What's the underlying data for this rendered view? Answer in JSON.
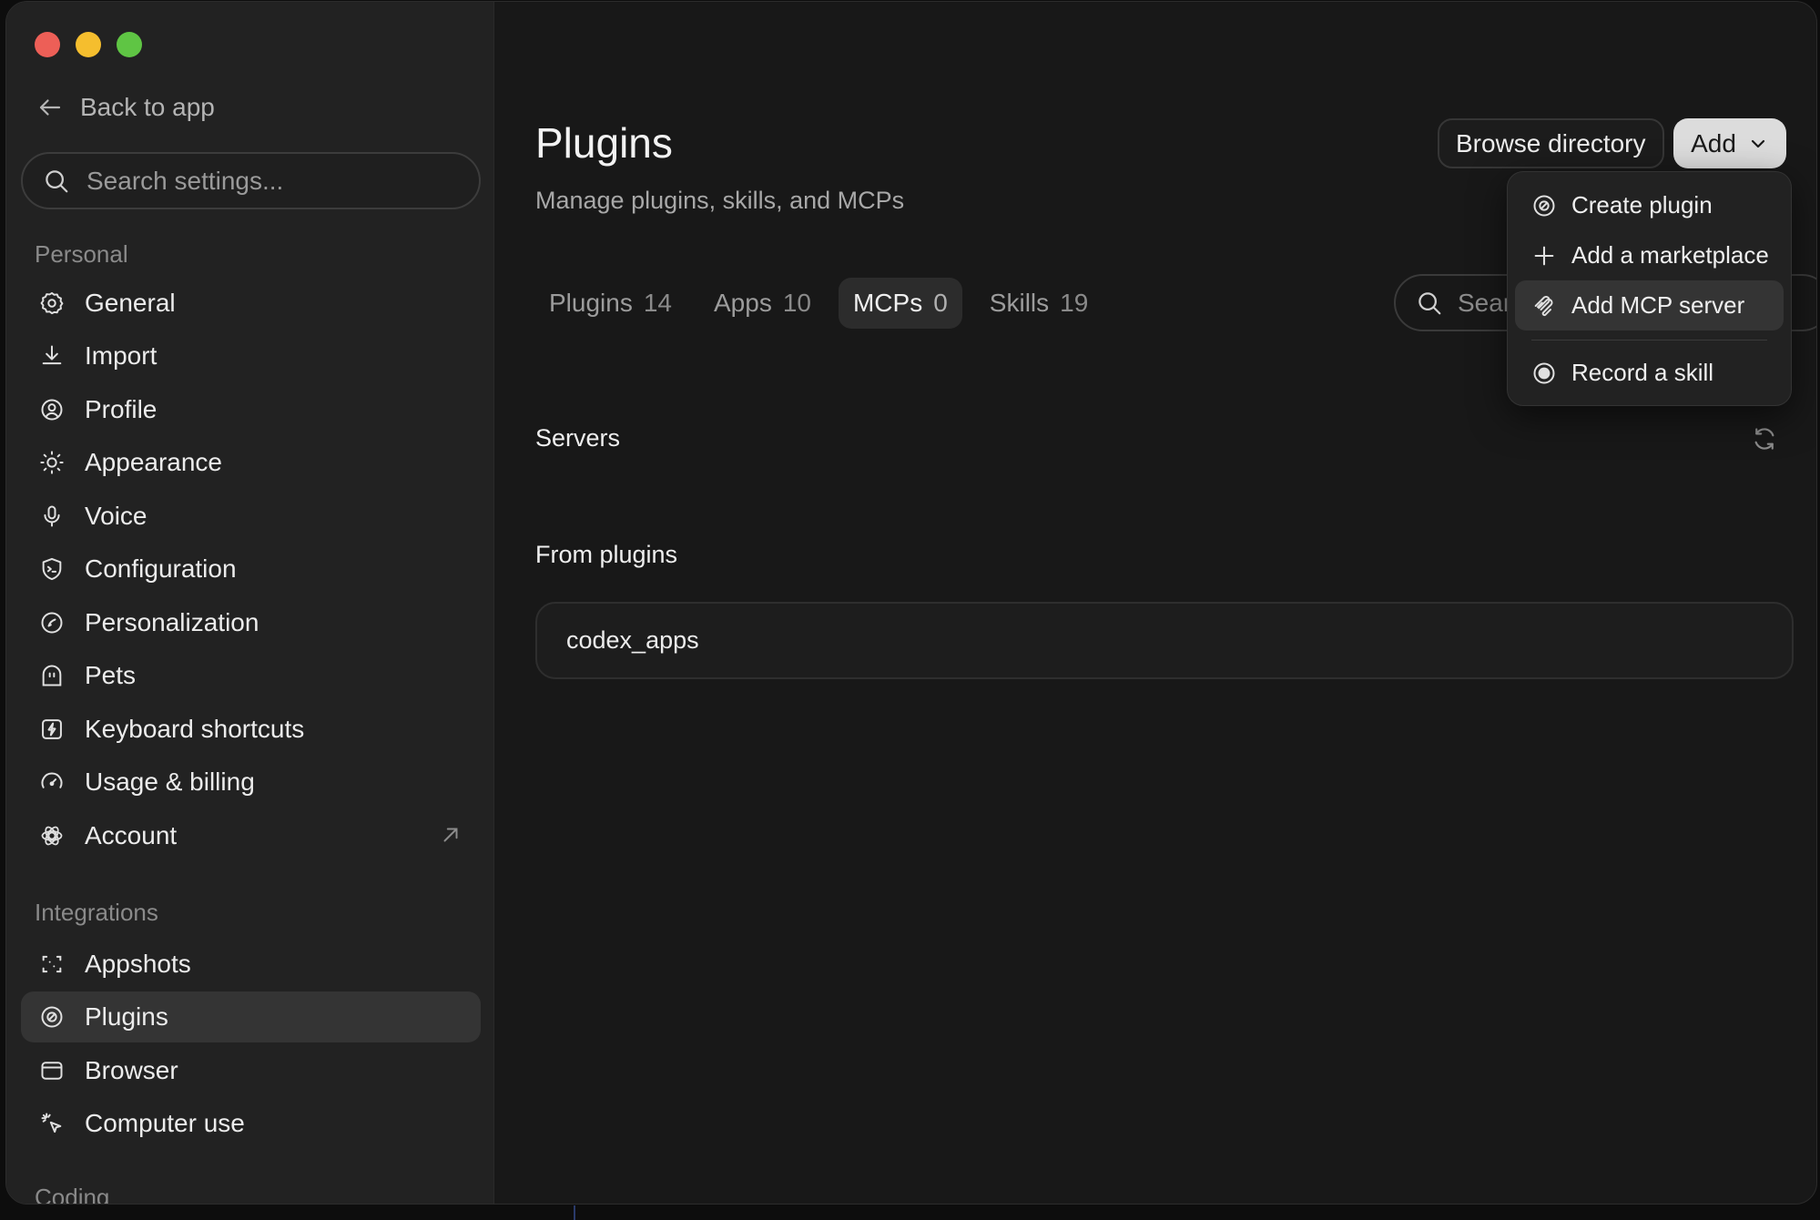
{
  "sidebar": {
    "back_label": "Back to app",
    "search_placeholder": "Search settings...",
    "sections": {
      "personal": "Personal",
      "integrations": "Integrations",
      "coding": "Coding"
    },
    "personal_items": [
      {
        "label": "General",
        "icon": "gear-icon"
      },
      {
        "label": "Import",
        "icon": "download-icon"
      },
      {
        "label": "Profile",
        "icon": "user-circle-icon"
      },
      {
        "label": "Appearance",
        "icon": "sun-icon"
      },
      {
        "label": "Voice",
        "icon": "microphone-icon"
      },
      {
        "label": "Configuration",
        "icon": "terminal-shield-icon"
      },
      {
        "label": "Personalization",
        "icon": "personalization-icon"
      },
      {
        "label": "Pets",
        "icon": "pet-icon"
      },
      {
        "label": "Keyboard shortcuts",
        "icon": "bolt-square-icon"
      },
      {
        "label": "Usage & billing",
        "icon": "gauge-icon"
      },
      {
        "label": "Account",
        "icon": "openai-logo-icon"
      }
    ],
    "integration_items": [
      {
        "label": "Appshots",
        "icon": "screenshot-icon"
      },
      {
        "label": "Plugins",
        "icon": "plugin-icon",
        "active": true
      },
      {
        "label": "Browser",
        "icon": "browser-window-icon"
      },
      {
        "label": "Computer use",
        "icon": "cursor-click-icon"
      }
    ]
  },
  "main": {
    "title": "Plugins",
    "subtitle": "Manage plugins, skills, and MCPs",
    "browse_label": "Browse directory",
    "add_label": "Add",
    "tabs": [
      {
        "label": "Plugins",
        "count": "14"
      },
      {
        "label": "Apps",
        "count": "10"
      },
      {
        "label": "MCPs",
        "count": "0",
        "active": true
      },
      {
        "label": "Skills",
        "count": "19"
      }
    ],
    "search_placeholder": "Sear",
    "servers_heading": "Servers",
    "from_plugins_heading": "From plugins",
    "from_plugins_items": [
      "codex_apps"
    ]
  },
  "dropdown": {
    "items": [
      {
        "label": "Create plugin",
        "icon": "plugin-icon"
      },
      {
        "label": "Add a marketplace",
        "icon": "plus-icon"
      },
      {
        "label": "Add MCP server",
        "icon": "mcp-icon",
        "hover": true
      },
      {
        "label": "Record a skill",
        "icon": "record-icon"
      }
    ]
  },
  "colors": {
    "window_bg": "#181818",
    "sidebar_bg": "#222222",
    "active_item_bg": "#343434",
    "add_button_bg": "#dcdcdc",
    "traffic_red": "#ed5f57",
    "traffic_yellow": "#f5be2e",
    "traffic_green": "#5fc544"
  }
}
